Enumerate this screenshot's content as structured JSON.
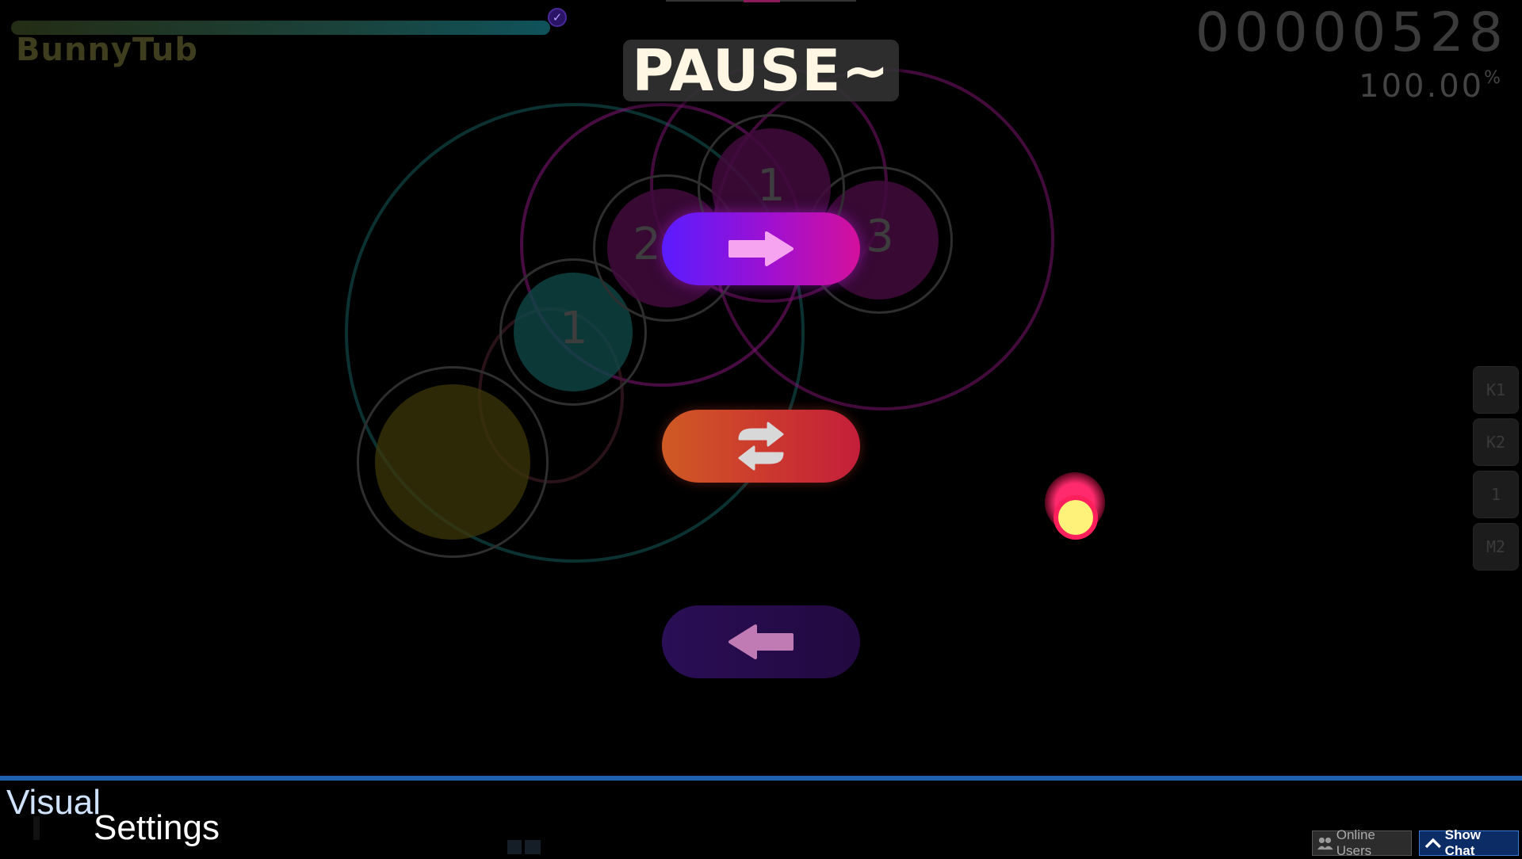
{
  "hud": {
    "player_name": "BunnyTub",
    "health_end_icon": "check-icon",
    "score": "00000528",
    "accuracy": "100.00",
    "accuracy_unit": "%"
  },
  "pause": {
    "title": "PAUSE~",
    "continue_icon": "arrow-right-icon",
    "retry_icon": "retry-icon",
    "back_icon": "arrow-left-icon"
  },
  "playfield": {
    "combo_numbers": [
      "1",
      "2",
      "3",
      "1"
    ]
  },
  "keys": [
    "K1",
    "K2",
    "1",
    "M2"
  ],
  "bottom": {
    "panel_title_1": "Visual",
    "panel_title_2": "Settings",
    "online_users_label": "Online Users",
    "show_chat_label": "Show Chat",
    "online_users_icon": "users-icon",
    "show_chat_icon": "chevron-up-icon"
  },
  "colors": {
    "accent_blue": "#1e5fb0",
    "continue_gradient": [
      "#5a1cff",
      "#d4109c"
    ],
    "retry_gradient": [
      "#cf5a24",
      "#c41e3a"
    ],
    "back_gradient": [
      "#2a0e56",
      "#22093f"
    ],
    "cursor_ring": "#ff1f5c",
    "cursor_fill": "#fff27a"
  }
}
